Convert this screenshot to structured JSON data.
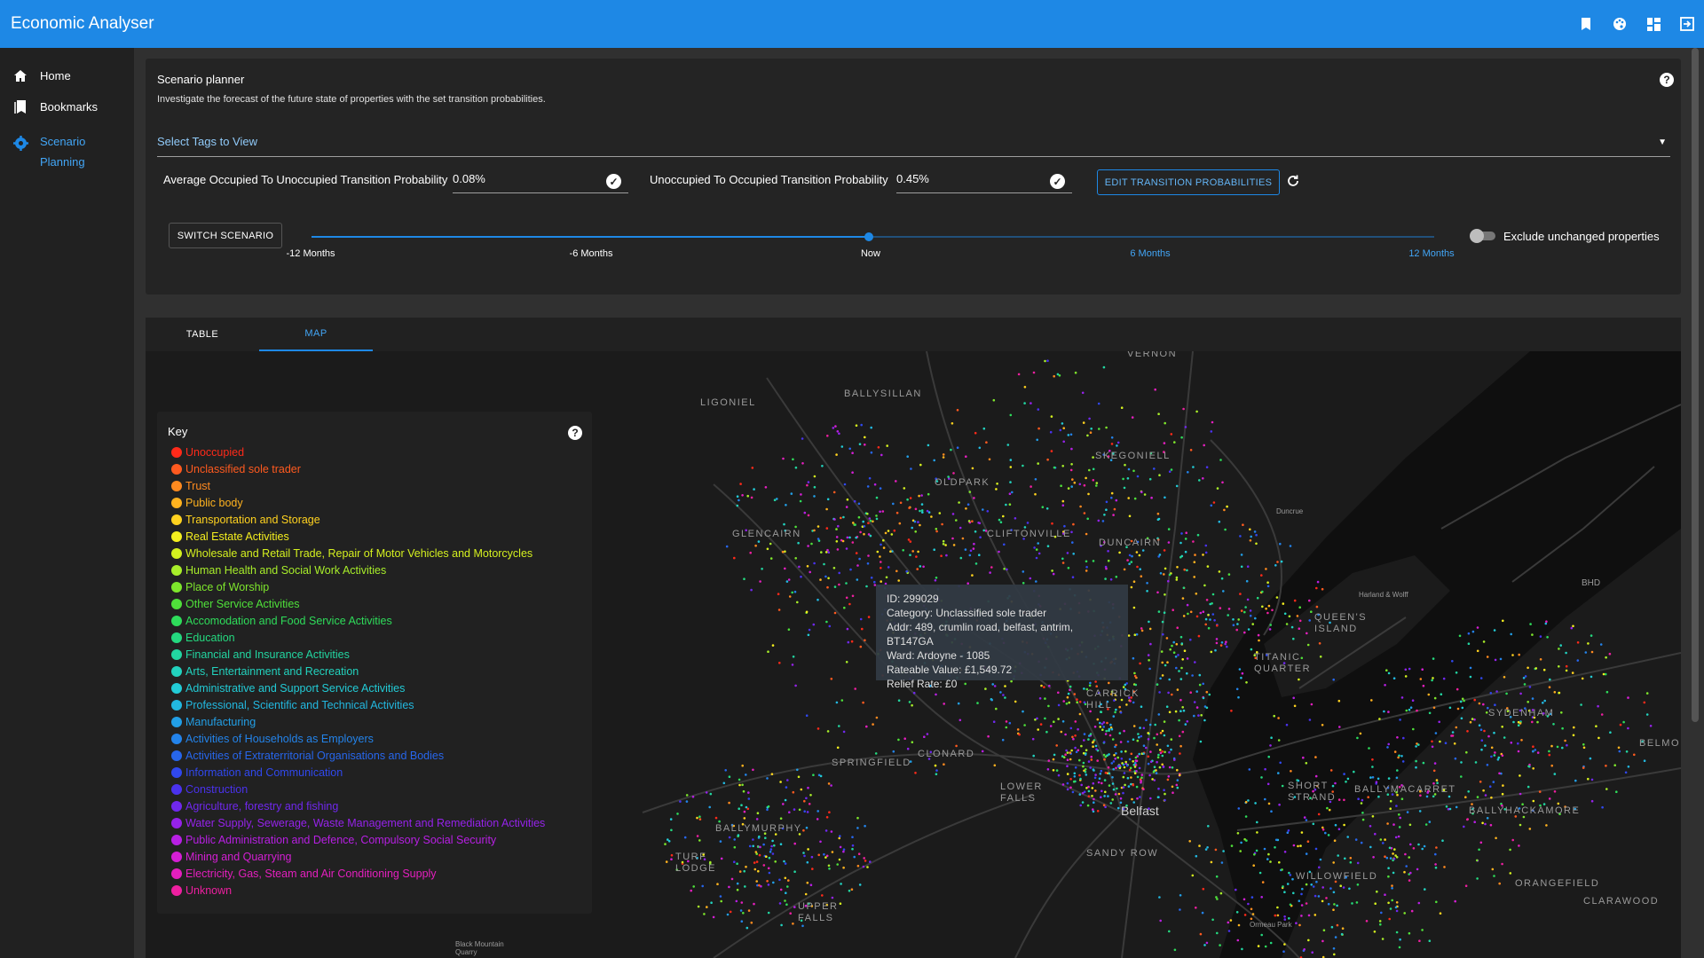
{
  "app": {
    "title": "Economic Analyser",
    "accent": "#1e88e5",
    "actions": [
      "bookmark-icon",
      "palette-icon",
      "dashboard-icon",
      "logout-icon"
    ]
  },
  "sidebar": {
    "items": [
      {
        "label": "Home",
        "icon": "home-icon"
      },
      {
        "label": "Bookmarks",
        "icon": "bookmarks-icon"
      },
      {
        "label": "Scenario Planning",
        "icon": "settings-icon",
        "active": true
      }
    ]
  },
  "planner": {
    "title": "Scenario planner",
    "description": "Investigate the forecast of the future state of properties with the set transition probabilities.",
    "tags_placeholder": "Select Tags to View",
    "occ_to_unocc_label": "Average Occupied To Unoccupied Transition Probability",
    "occ_to_unocc_value": "0.08%",
    "unocc_to_occ_label": "Unoccupied To Occupied Transition Probability",
    "unocc_to_occ_value": "0.45%",
    "edit_button": "EDIT TRANSITION PROBABILITIES",
    "switch_button": "SWITCH SCENARIO",
    "slider": {
      "marks": [
        "-12 Months",
        "-6 Months",
        "Now",
        "6 Months",
        "12 Months"
      ],
      "value": "Now"
    },
    "exclude_label": "Exclude unchanged properties",
    "exclude_on": false
  },
  "tabs": {
    "items": [
      "TABLE",
      "MAP"
    ],
    "active": "MAP"
  },
  "map": {
    "places": [
      "VERNON",
      "LIGONIEL",
      "BALLYSILLAN",
      "SKEGONIELL",
      "OLDPARK",
      "GLENCAIRN",
      "CLIFTONVILLE",
      "DUNCAIRN",
      "QUEEN'S ISLAND",
      "TITANIC QUARTER",
      "CARRICK HILL",
      "CLONARD",
      "SPRINGFIELD",
      "LOWER FALLS",
      "Belfast",
      "SHORT STRAND",
      "BALLYMACARRET",
      "SYDENHAM",
      "BALLYMURPHY",
      "SANDY ROW",
      "WILLOWFIELD",
      "BALLYHACKAMORE",
      "ORANGEFIELD",
      "TURF LODGE",
      "UPPER FALLS",
      "CLARAWOOD",
      "BHD",
      "BELMO",
      "Black Mountain Quarry",
      "Ormeau Park",
      "Duncrue",
      "Harland & Wolff"
    ],
    "legend": {
      "title": "Key",
      "items": [
        {
          "label": "Unoccupied",
          "color": "#ff2a1a"
        },
        {
          "label": "Unclassified sole trader",
          "color": "#ff5a1f"
        },
        {
          "label": "Trust",
          "color": "#ff8a1f"
        },
        {
          "label": "Public body",
          "color": "#ffb21f"
        },
        {
          "label": "Transportation and Storage",
          "color": "#ffd21f"
        },
        {
          "label": "Real Estate Activities",
          "color": "#f5ef1f"
        },
        {
          "label": "Wholesale and Retail Trade, Repair of Motor Vehicles and Motorcycles",
          "color": "#d4f01f"
        },
        {
          "label": "Human Health and Social Work Activities",
          "color": "#a8ee2a"
        },
        {
          "label": "Place of Worship",
          "color": "#7ee62c"
        },
        {
          "label": "Other Service Activities",
          "color": "#4fe03a"
        },
        {
          "label": "Accomodation and Food Service Activities",
          "color": "#2edc5a"
        },
        {
          "label": "Education",
          "color": "#24d97f"
        },
        {
          "label": "Financial and Insurance Activities",
          "color": "#22d6a1"
        },
        {
          "label": "Arts, Entertainment and Recreation",
          "color": "#22d2be"
        },
        {
          "label": "Administrative and Support Service Activities",
          "color": "#22cbd6"
        },
        {
          "label": "Professional, Scientific and Technical Activities",
          "color": "#22b8e0"
        },
        {
          "label": "Manufacturing",
          "color": "#229fe6"
        },
        {
          "label": "Activities of Households as Employers",
          "color": "#2383ea"
        },
        {
          "label": "Activities of Extraterritorial Organisations and Bodies",
          "color": "#2766ec"
        },
        {
          "label": "Information and Communication",
          "color": "#3048ee"
        },
        {
          "label": "Construction",
          "color": "#4a32ee"
        },
        {
          "label": "Agriculture, forestry and fishing",
          "color": "#7028ee"
        },
        {
          "label": "Water Supply, Sewerage, Waste Management and Remediation Activities",
          "color": "#9522ea"
        },
        {
          "label": "Public Administration and Defence, Compulsory Social Security",
          "color": "#b81fe4"
        },
        {
          "label": "Mining and Quarrying",
          "color": "#d41fd4"
        },
        {
          "label": "Electricity, Gas, Steam and Air Conditioning Supply",
          "color": "#e41fbe"
        },
        {
          "label": "Unknown",
          "color": "#ee1fa0"
        }
      ]
    },
    "tooltip": {
      "id": "ID: 299029",
      "category": "Category: Unclassified sole trader",
      "addr": "Addr: 489, crumlin road, belfast, antrim, BT147GA",
      "ward": "Ward: Ardoyne - 1085",
      "rateable": "Rateable Value: £1,549.72",
      "relief": "Relief Rate: £0"
    }
  }
}
